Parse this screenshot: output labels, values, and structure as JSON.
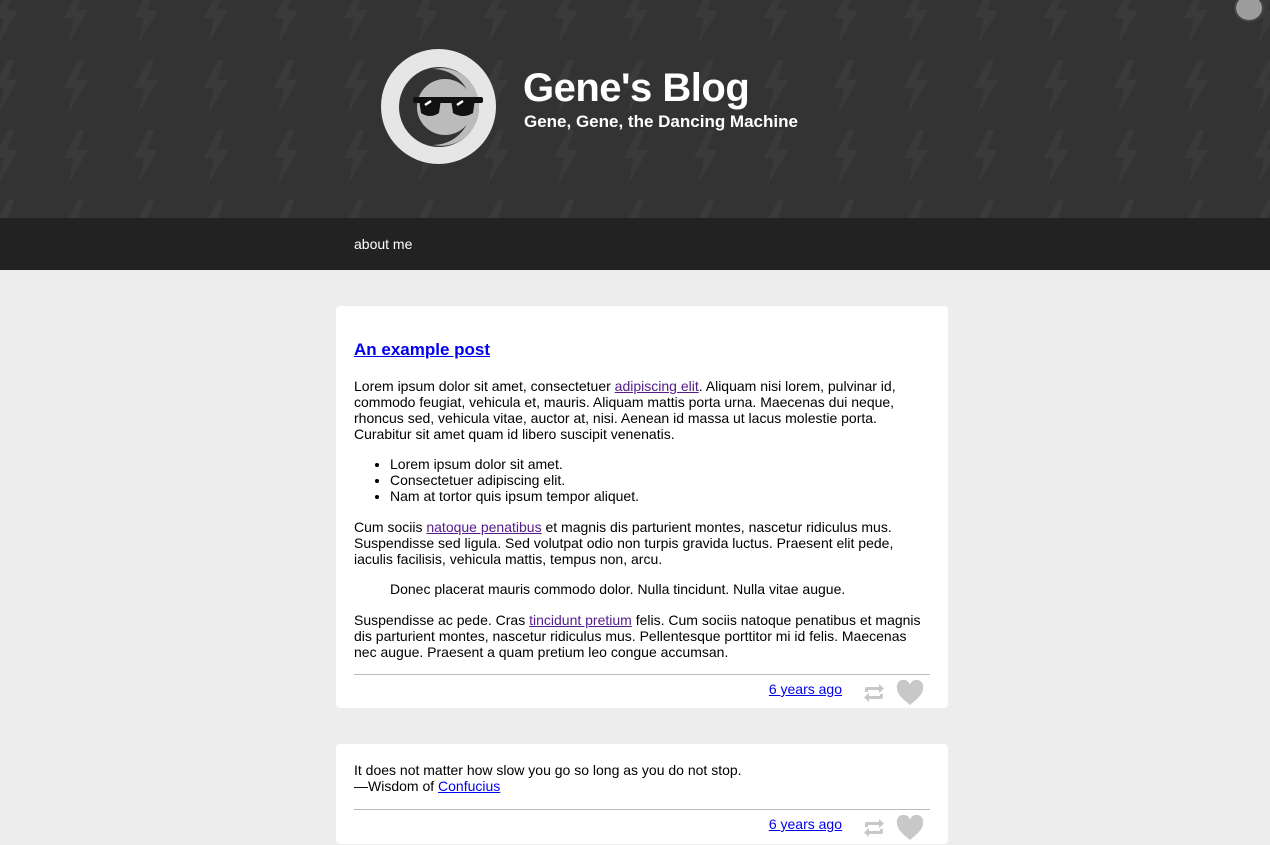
{
  "header": {
    "title": "Gene's Blog",
    "subtitle": "Gene, Gene, the Dancing Machine",
    "avatar_icon": "sunglasses-avatar-icon",
    "pattern_icon": "lightning-bolt-icon",
    "background_color": "#333333"
  },
  "nav": {
    "about_label": "about me"
  },
  "posts": [
    {
      "title": "An example post",
      "p1_before": "Lorem ipsum dolor sit amet, consectetuer ",
      "p1_link": "adipiscing elit",
      "p1_after": ". Aliquam nisi lorem, pulvinar id, commodo feugiat, vehicula et, mauris. Aliquam mattis porta urna. Maecenas dui neque, rhoncus sed, vehicula vitae, auctor at, nisi. Aenean id massa ut lacus molestie porta. Curabitur sit amet quam id libero suscipit venenatis.",
      "list": [
        "Lorem ipsum dolor sit amet.",
        "Consectetuer adipiscing elit.",
        "Nam at tortor quis ipsum tempor aliquet."
      ],
      "p2_before": "Cum sociis ",
      "p2_link": "natoque penatibus",
      "p2_after": " et magnis dis parturient montes, nascetur ridiculus mus. Suspendisse sed ligula. Sed volutpat odio non turpis gravida luctus. Praesent elit pede, iaculis facilisis, vehicula mattis, tempus non, arcu.",
      "blockquote": "Donec placerat mauris commodo dolor. Nulla tincidunt. Nulla vitae augue.",
      "p3_before": "Suspendisse ac pede. Cras ",
      "p3_link": "tincidunt pretium",
      "p3_after": " felis. Cum sociis natoque penatibus et magnis dis parturient montes, nascetur ridiculus mus. Pellentesque porttitor mi id felis. Maecenas nec augue. Praesent a quam pretium leo congue accumsan.",
      "timestamp": "6 years ago"
    },
    {
      "quote": "It does not matter how slow you go so long as you do not stop.",
      "source_prefix": "—Wisdom of ",
      "source_link": "Confucius",
      "timestamp": "6 years ago"
    }
  ],
  "footer_icons": {
    "reblog": "reblog-icon",
    "like": "heart-icon",
    "icon_color": "#c8c8c8"
  }
}
